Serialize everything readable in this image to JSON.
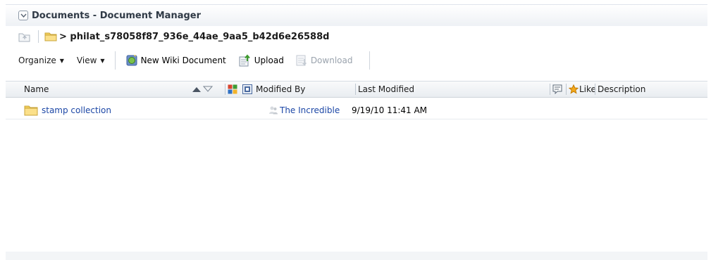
{
  "header": {
    "title": "Documents - Document Manager",
    "disclosure_state": "expanded"
  },
  "path": {
    "text": "> philat_s78058f87_936e_44ae_9aa5_b42d6e26588d"
  },
  "toolbar": {
    "organize_label": "Organize",
    "view_label": "View",
    "new_wiki_label": "New Wiki Document",
    "upload_label": "Upload",
    "download_label": "Download"
  },
  "columns": {
    "name": "Name",
    "modified_by": "Modified By",
    "last_modified": "Last Modified",
    "like": "Like",
    "description": "Description"
  },
  "rows": [
    {
      "name": "stamp collection",
      "modified_by": "The Incredible",
      "last_modified": "9/19/10 11:41 AM"
    }
  ],
  "colors": {
    "link": "#1c47a6",
    "folder": "#f2cf5b",
    "header_bg": "#eef1f5"
  }
}
